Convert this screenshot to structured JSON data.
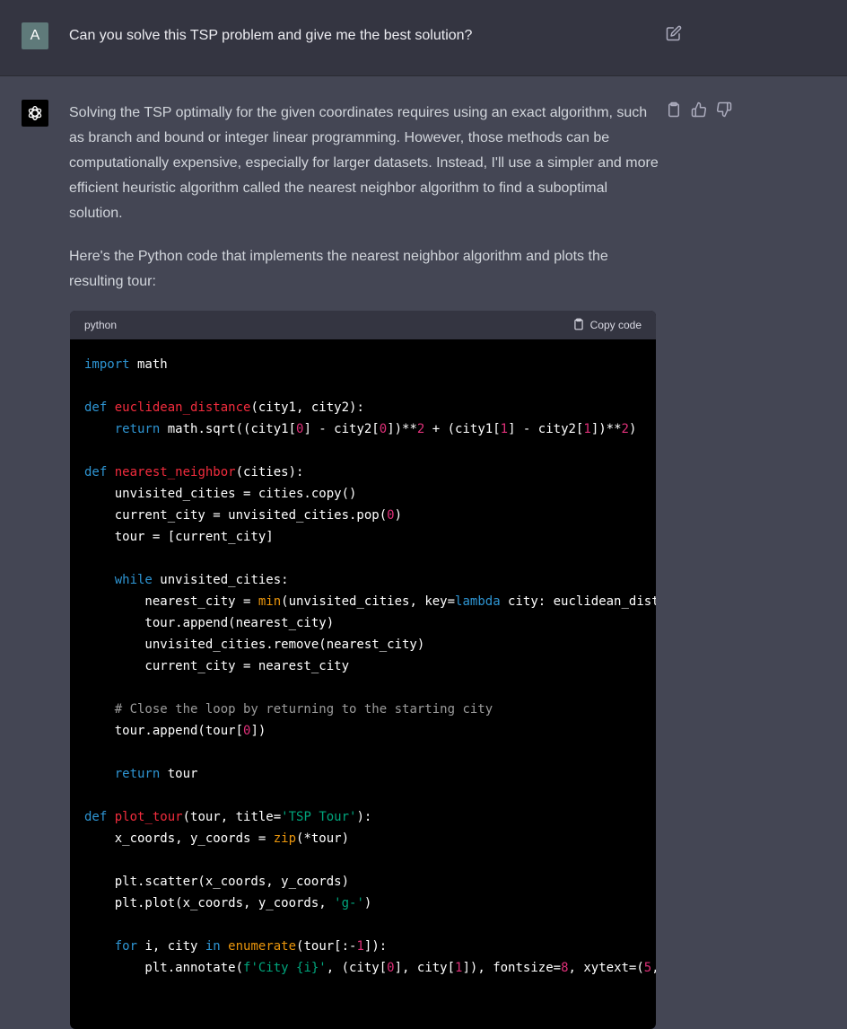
{
  "user": {
    "avatar_letter": "A",
    "message": "Can you solve this TSP problem and give me the best solution?"
  },
  "assistant": {
    "paragraph1": "Solving the TSP optimally for the given coordinates requires using an exact algorithm, such as branch and bound or integer linear programming. However, those methods can be computationally expensive, especially for larger datasets. Instead, I'll use a simpler and more efficient heuristic algorithm called the nearest neighbor algorithm to find a suboptimal solution.",
    "paragraph2": "Here's the Python code that implements the nearest neighbor algorithm and plots the resulting tour:",
    "code_language": "python",
    "copy_label": "Copy code"
  },
  "icons": {
    "edit": "edit-icon",
    "copy": "clipboard-icon",
    "thumbs_up": "thumbs-up-icon",
    "thumbs_down": "thumbs-down-icon",
    "bot_logo": "openai-logo-icon"
  },
  "colors": {
    "user_bg": "#343541",
    "assistant_bg": "#444654",
    "code_bg": "#000000",
    "keyword": "#2e95d3",
    "function": "#f22c3d",
    "number": "#df3079",
    "string": "#00a67d"
  }
}
